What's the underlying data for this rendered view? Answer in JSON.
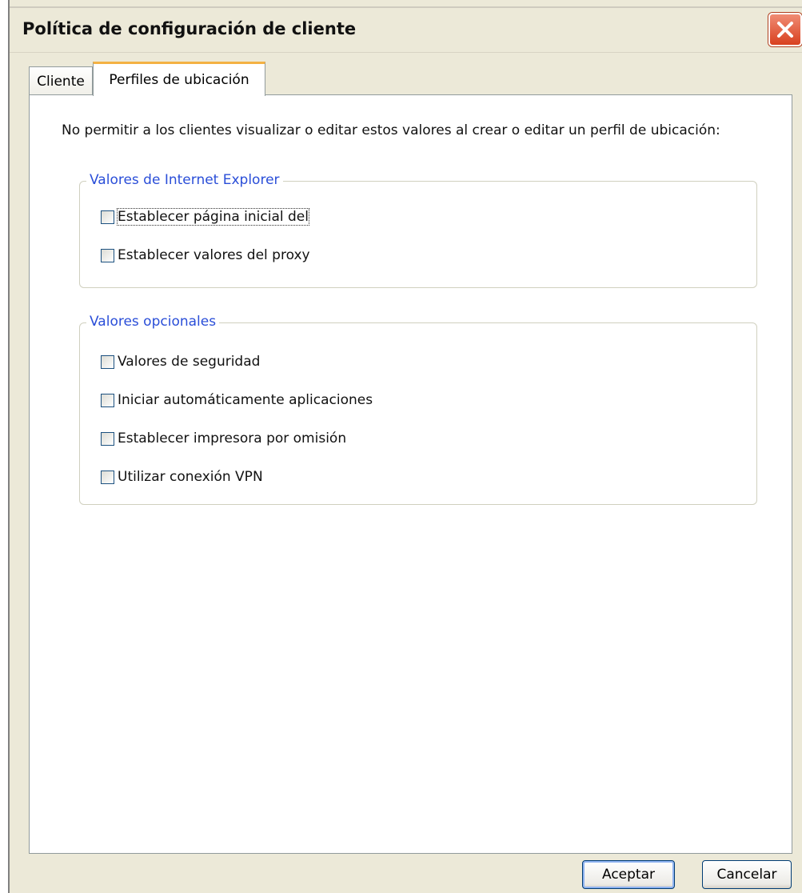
{
  "window": {
    "title": "Política de configuración de cliente"
  },
  "tabs": [
    {
      "label": "Cliente",
      "selected": false
    },
    {
      "label": "Perfiles de ubicación",
      "selected": true
    }
  ],
  "panel": {
    "intro": "No permitir a los clientes visualizar o editar estos valores al crear o editar un perfil de ubicación:",
    "groups": [
      {
        "legend": "Valores de Internet Explorer",
        "items": [
          {
            "label": "Establecer página inicial del",
            "checked": false
          },
          {
            "label": "Establecer valores del proxy",
            "checked": false
          }
        ]
      },
      {
        "legend": "Valores opcionales",
        "items": [
          {
            "label": "Valores de seguridad",
            "checked": false
          },
          {
            "label": "Iniciar automáticamente aplicaciones",
            "checked": false
          },
          {
            "label": "Establecer impresora por omisión",
            "checked": false
          },
          {
            "label": "Utilizar conexión VPN",
            "checked": false
          }
        ]
      }
    ]
  },
  "buttons": {
    "ok": "Aceptar",
    "cancel": "Cancelar"
  },
  "colors": {
    "dialog_bg": "#ece9d8",
    "legend_text": "#2a4ed8",
    "selected_tab_accent": "#f4b143",
    "close_button": "#d8401f"
  },
  "icons": {
    "close": "close-icon"
  }
}
